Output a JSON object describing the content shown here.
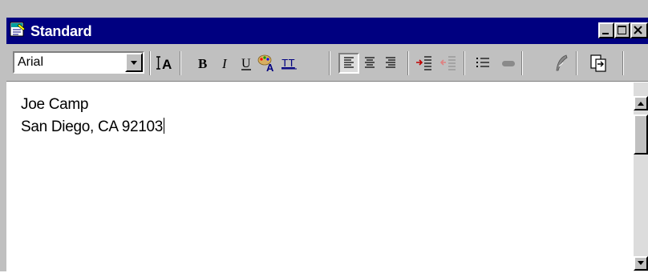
{
  "window": {
    "title": "Standard",
    "controls": {
      "minimize_icon": "minimize-icon",
      "maximize_icon": "maximize-icon",
      "close_icon": "close-icon"
    }
  },
  "toolbar": {
    "font_name": "Arial",
    "buttons": [
      {
        "name": "font-size-button",
        "icon": "font-size-icon"
      },
      {
        "name": "bold-button",
        "icon": "bold-icon"
      },
      {
        "name": "italic-button",
        "icon": "italic-icon"
      },
      {
        "name": "underline-button",
        "icon": "underline-icon"
      },
      {
        "name": "font-color-button",
        "icon": "font-color-icon"
      },
      {
        "name": "teletype-button",
        "icon": "teletype-icon"
      },
      {
        "name": "align-left-button",
        "icon": "align-left-icon",
        "active": true
      },
      {
        "name": "align-center-button",
        "icon": "align-center-icon"
      },
      {
        "name": "align-right-button",
        "icon": "align-right-icon"
      },
      {
        "name": "increase-indent-button",
        "icon": "increase-indent-icon"
      },
      {
        "name": "decrease-indent-button",
        "icon": "decrease-indent-icon"
      },
      {
        "name": "bullet-list-button",
        "icon": "bullet-list-icon"
      },
      {
        "name": "pill-button",
        "icon": "pill-icon"
      },
      {
        "name": "spellcheck-button",
        "icon": "spellcheck-icon"
      },
      {
        "name": "insert-button",
        "icon": "insert-icon"
      }
    ]
  },
  "document": {
    "lines": [
      "Joe Camp",
      "San Diego, CA 92103"
    ]
  },
  "colors": {
    "titlebar": "#000080",
    "face": "#c0c0c0"
  }
}
